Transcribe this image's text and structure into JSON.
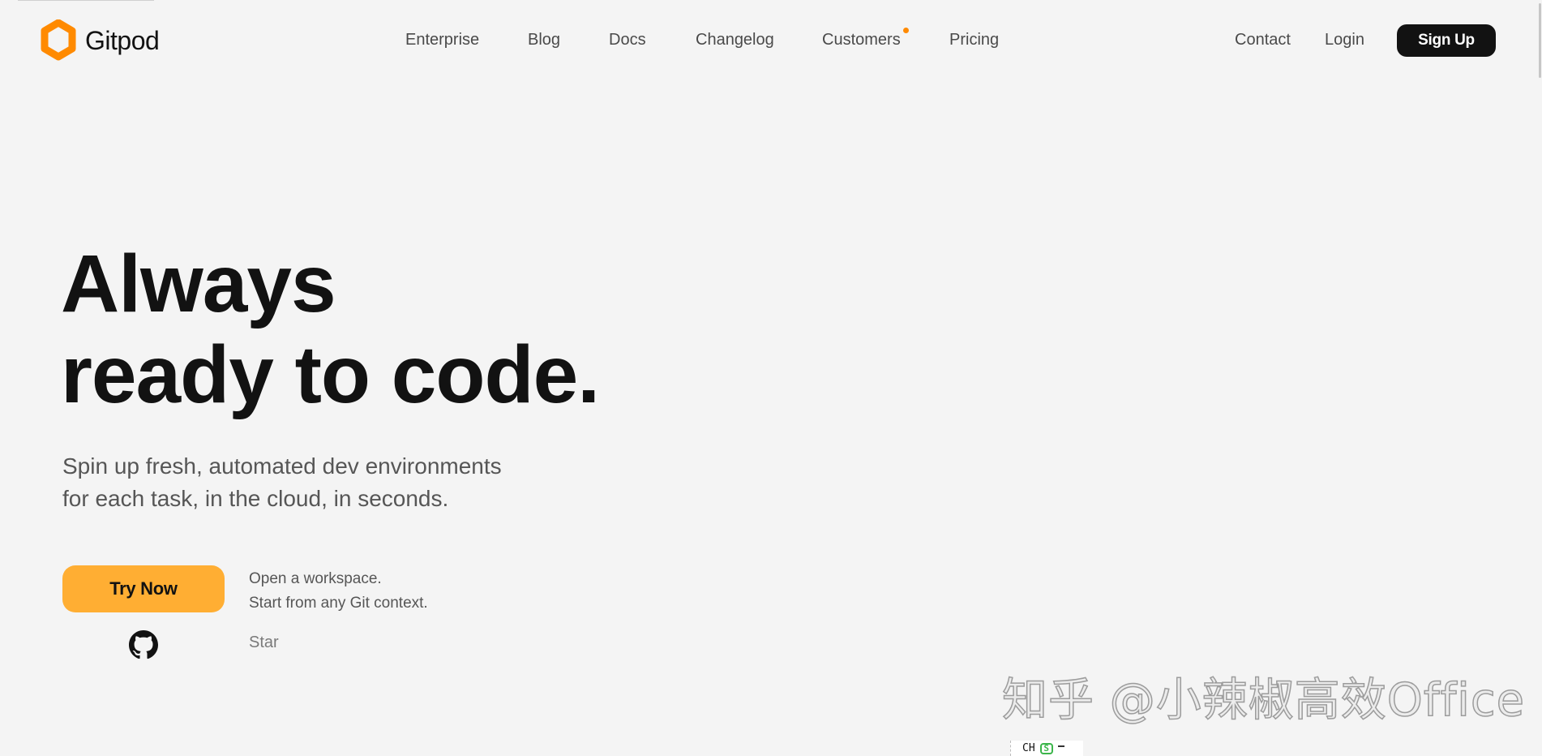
{
  "brand": {
    "name": "Gitpod",
    "logo_color": "#ff8a00"
  },
  "nav": {
    "items": [
      {
        "label": "Enterprise"
      },
      {
        "label": "Blog"
      },
      {
        "label": "Docs"
      },
      {
        "label": "Changelog"
      },
      {
        "label": "Customers",
        "badge": "new-dot"
      },
      {
        "label": "Pricing"
      }
    ],
    "contact": "Contact",
    "login": "Login",
    "signup": "Sign Up"
  },
  "hero": {
    "title_line1": "Always",
    "title_line2": "ready to code.",
    "subtitle_line1": "Spin up fresh, automated dev environments",
    "subtitle_line2": "for each task, in the cloud, in seconds.",
    "cta_label": "Try Now",
    "cta_color": "#ffae33",
    "cta_note_line1": "Open a workspace.",
    "cta_note_line2": "Start from any Git context.",
    "github_icon": "github-icon",
    "star_label": "Star"
  },
  "overlay": {
    "watermark": "知乎 @小辣椒高效Office",
    "ime_text": "CH"
  }
}
